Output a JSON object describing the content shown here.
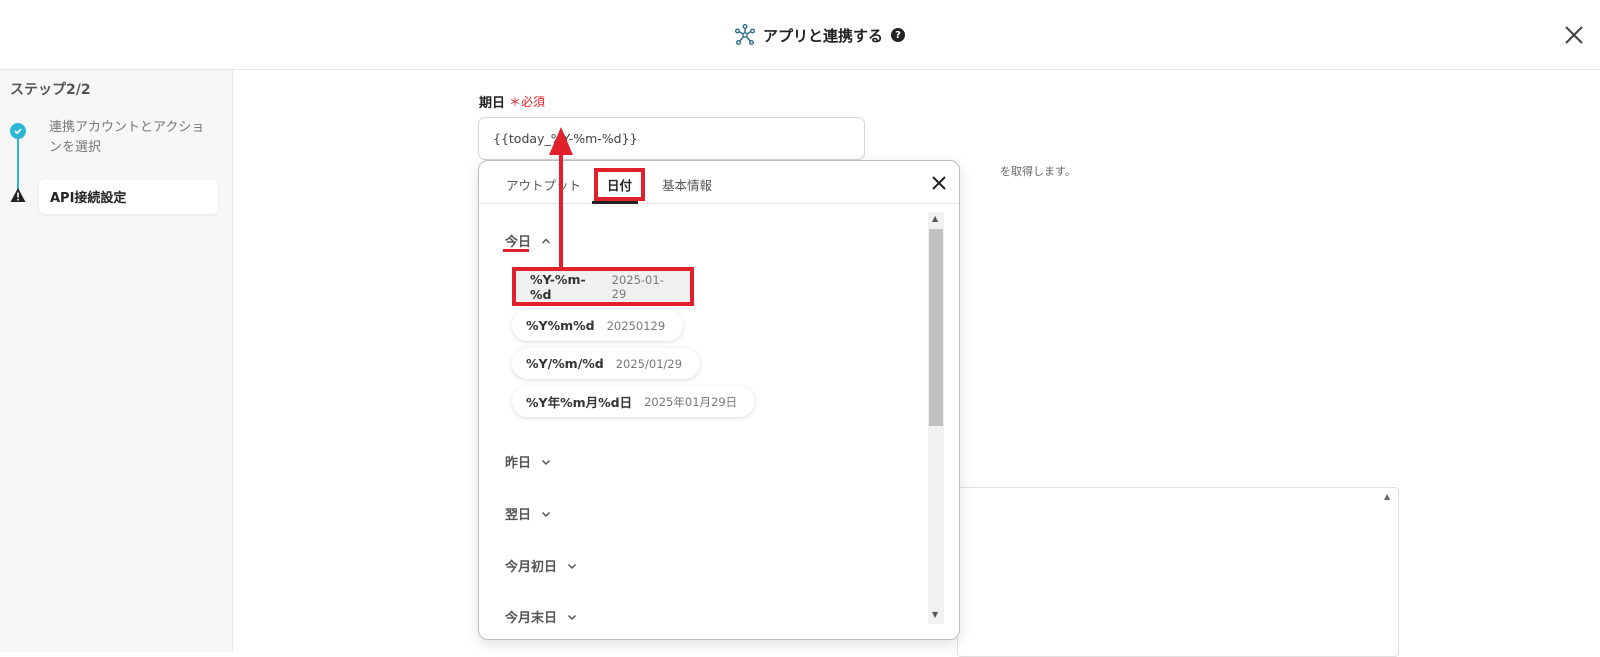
{
  "header": {
    "title": "アプリと連携する",
    "help_glyph": "?"
  },
  "sidebar": {
    "step_title": "ステップ2/2",
    "steps": [
      {
        "label": "連携アカウントとアクションを選択",
        "status": "done"
      },
      {
        "label": "API接続設定",
        "status": "current"
      }
    ]
  },
  "field": {
    "label": "期日",
    "required": "＊必須",
    "value": "{{today_%Y-%m-%d}}",
    "hint": "を取得します。"
  },
  "popup": {
    "tabs": [
      {
        "label": "アウトプット"
      },
      {
        "label": "日付"
      },
      {
        "label": "基本情報"
      }
    ],
    "sections": {
      "today": "今日",
      "yesterday": "昨日",
      "tomorrow": "翌日",
      "month_start": "今月初日",
      "month_end": "今月末日"
    },
    "formats": [
      {
        "format": "%Y-%m-%d",
        "example": "2025-01-29"
      },
      {
        "format": "%Y%m%d",
        "example": "20250129"
      },
      {
        "format": "%Y/%m/%d",
        "example": "2025/01/29"
      },
      {
        "format": "%Y年%m月%d日",
        "example": "2025年01月29日"
      }
    ]
  },
  "colors": {
    "accent": "#2bb6d6",
    "annotation": "#e0202a"
  }
}
